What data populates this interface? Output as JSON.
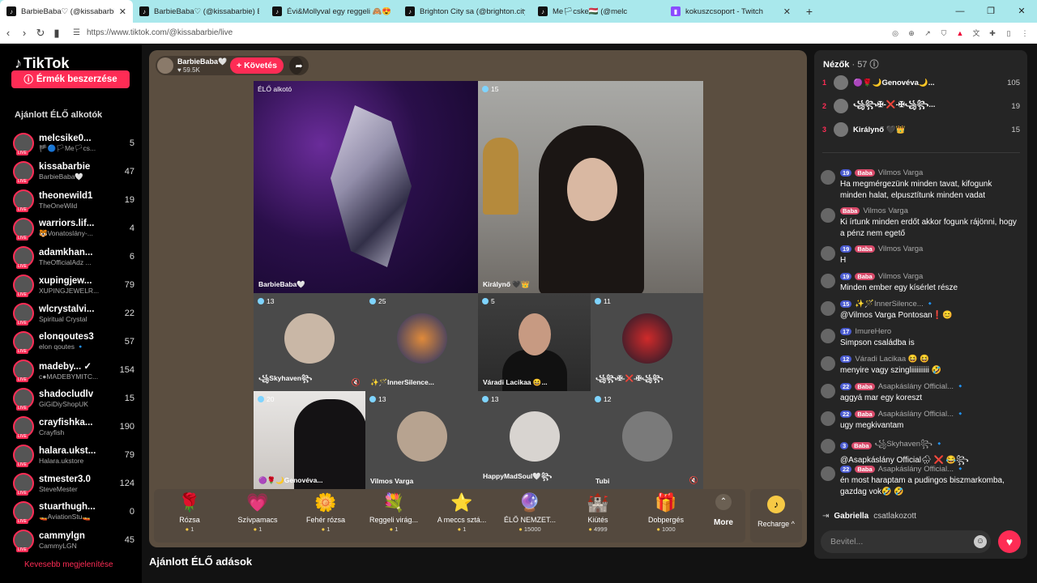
{
  "browser": {
    "tabs": [
      {
        "title": "BarbieBaba♡ (@kissabarbie)",
        "active": true
      },
      {
        "title": "BarbieBaba♡ (@kissabarbie) ÉLŐ"
      },
      {
        "title": "Évi&Mollyval egy reggeli 🙈😍 (@m"
      },
      {
        "title": "Brighton City sa (@brighton.city) ÉLŐ"
      },
      {
        "title": "Me🏳cske🇭🇺 (@melc"
      },
      {
        "title": "kokuszcsoport - Twitch"
      }
    ],
    "url": "https://www.tiktok.com/@kissabarbie/live"
  },
  "sidebar": {
    "logo": "TikTok",
    "coins_button": "Érmék beszerzése",
    "section_title": "Ajánlott ÉLŐ alkotók",
    "creators": [
      {
        "name": "melcsike0...",
        "sub": "🏴🔵🏳Me🏳cs...",
        "count": "5"
      },
      {
        "name": "kissabarbie",
        "sub": "BarbieBaba🤍",
        "count": "47"
      },
      {
        "name": "theonewild1",
        "sub": "TheOneWild",
        "count": "19"
      },
      {
        "name": "warriors.lif...",
        "sub": "🐯Vonatoslány-...",
        "count": "4"
      },
      {
        "name": "adamkhan...",
        "sub": "TheOfficialAdz ...",
        "count": "6"
      },
      {
        "name": "xupingjew...",
        "sub": "XUPINGJEWELR...",
        "count": "79"
      },
      {
        "name": "wlcrystalvi...",
        "sub": "Spiritual Crystal",
        "count": "22"
      },
      {
        "name": "elonqoutes3",
        "sub": "elon qoutes 🔹",
        "count": "57"
      },
      {
        "name": "madeby... ✓",
        "sub": "c●MADEBYMITC...",
        "count": "154"
      },
      {
        "name": "shadocludlv",
        "sub": "GiGiDiyShopUK",
        "count": "15"
      },
      {
        "name": "crayfishka...",
        "sub": "Crayfish",
        "count": "190"
      },
      {
        "name": "halara.ukst...",
        "sub": "Halara.ukstore",
        "count": "79"
      },
      {
        "name": "stmester3.0",
        "sub": "SteveMester",
        "count": "124"
      },
      {
        "name": "stuarthugh...",
        "sub": "🚤AviationStu🚤",
        "count": "0"
      },
      {
        "name": "cammylgn",
        "sub": "CammyLGN",
        "count": "45"
      }
    ],
    "see_more": "Kevesebb megjelenítése"
  },
  "live": {
    "host_name": "BarbieBaba🤍",
    "host_likes": "♥ 59.5K",
    "follow_label": "+ Követés",
    "cells": [
      {
        "label": "BarbieBaba🤍",
        "badge": "ÉLŐ alkotó"
      },
      {
        "label": "Királynő 🖤👑",
        "badge": "15"
      },
      {
        "label": "꧁Skyhaven꧂",
        "badge": "13"
      },
      {
        "label": "✨🪄InnerSilence...",
        "badge": "25"
      },
      {
        "label": "Váradi Lacikaa 😆...",
        "badge": "5"
      },
      {
        "label": "꧁꧂✠-❌-✠꧁꧂",
        "badge": "11"
      },
      {
        "label": "🟣🌹🌙Genovéva...",
        "badge": "20"
      },
      {
        "label": "Vilmos Varga",
        "badge": "13"
      },
      {
        "label": "HappyMadSoul🤍꧂",
        "badge": "13"
      },
      {
        "label": "Tubi",
        "badge": "12"
      }
    ],
    "gifts": [
      {
        "icon": "🌹",
        "name": "Rózsa",
        "price": "1"
      },
      {
        "icon": "💗",
        "name": "Szívpamacs",
        "price": "1"
      },
      {
        "icon": "🌼",
        "name": "Fehér rózsa",
        "price": "1"
      },
      {
        "icon": "💐",
        "name": "Reggeli virág...",
        "price": "1"
      },
      {
        "icon": "⭐",
        "name": "A meccs sztá...",
        "price": "1"
      },
      {
        "icon": "🔮",
        "name": "ÉLŐ NEMZET...",
        "price": "15000"
      },
      {
        "icon": "🏰",
        "name": "Kiütés",
        "price": "4999"
      },
      {
        "icon": "🎁",
        "name": "Dobpergés",
        "price": "1000"
      }
    ],
    "more_label": "More",
    "recharge_label": "Recharge ^"
  },
  "section_title": "Ajánlott ÉLŐ adások",
  "chat": {
    "viewers_label": "Nézők",
    "viewers_count": "· 57",
    "ranking": [
      {
        "rank": "1",
        "name": "🟣🌹🌙Genovéva🌙...",
        "score": "105"
      },
      {
        "rank": "2",
        "name": "꧁꧂✠-❌-✠꧁꧂...",
        "score": "19"
      },
      {
        "rank": "3",
        "name": "Királynő 🖤👑",
        "score": "15"
      }
    ],
    "messages": [
      {
        "level": "19",
        "fan": "Baba",
        "user": "Vilmos Varga",
        "text": "Ha megmérgezünk minden tavat, kifogunk minden halat, elpusztítunk minden vadat"
      },
      {
        "level": "",
        "fan": "Baba",
        "user": "Vilmos Varga",
        "text": "Ki írtunk minden erdőt akkor fogunk rájönni, hogy a pénz nem egető"
      },
      {
        "level": "19",
        "fan": "Baba",
        "user": "Vilmos Varga",
        "text": "H"
      },
      {
        "level": "19",
        "fan": "Baba",
        "user": "Vilmos Varga",
        "text": "Minden ember egy kísérlet része"
      },
      {
        "level": "15",
        "fan": "",
        "user": "✨🪄InnerSilence... 🔹",
        "text": "@Vilmos Varga Pontosan❗😊"
      },
      {
        "level": "17",
        "fan": "",
        "user": "ImureHero",
        "text": "Simpson családba is"
      },
      {
        "level": "12",
        "fan": "",
        "user": "Váradi Lacikaa 😆 😆",
        "text": "menyire vagy szingliiiiiiiiii 🤣"
      },
      {
        "level": "22",
        "fan": "Baba",
        "user": "Asapkáslány Official... 🔹",
        "text": "aggyá mar egy koreszt"
      },
      {
        "level": "22",
        "fan": "Baba",
        "user": "Asapkáslány Official... 🔹",
        "text": "ugy megkivantam"
      },
      {
        "level": "3",
        "fan": "Baba",
        "user": "꧁Skyhaven꧂ 🔹",
        "text": "@Asapkáslány Official🌧 ❌ 😂꧂"
      },
      {
        "level": "22",
        "fan": "Baba",
        "user": "Asapkáslány Official... 🔹",
        "text": "én most haraptam a pudingos biszmarkomba, gazdag vok🤣 🤣"
      }
    ],
    "joined_user": "Gabriella",
    "joined_text": "csatlakozott",
    "input_placeholder": "Bevitel..."
  }
}
